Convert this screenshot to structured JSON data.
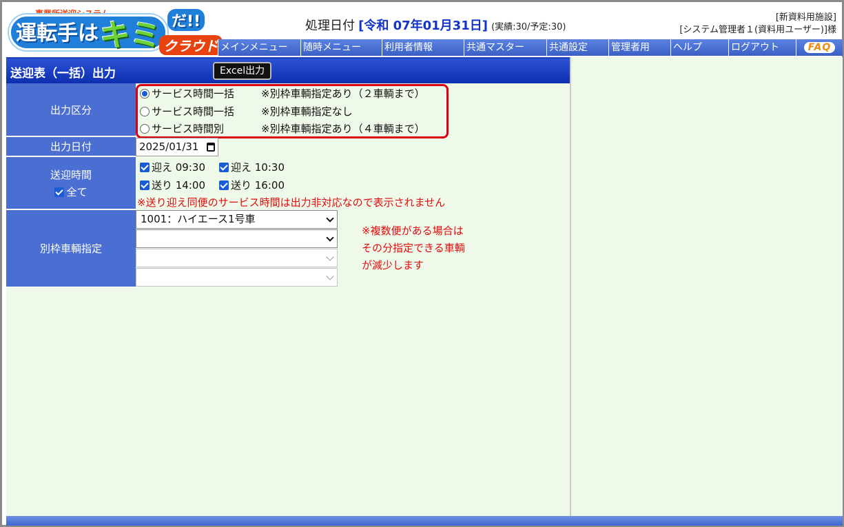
{
  "header": {
    "logo_sub": "事業所送迎システム",
    "logo_main": "運転手は",
    "logo_kimi": "キミ",
    "logo_da": "だ!!",
    "logo_cloud": "クラウド",
    "processing_label": "処理日付",
    "processing_date": "[令和 07年01月31日]",
    "status": "(実績:30/予定:30)",
    "facility": "[新資料用施設]",
    "user": "[システム管理者１(資料用ユーザー)]様"
  },
  "menu": [
    {
      "label": "メインメニュー"
    },
    {
      "label": "随時メニュー"
    },
    {
      "label": "利用者情報"
    },
    {
      "label": "共通マスター"
    },
    {
      "label": "共通設定"
    },
    {
      "label": "管理者用"
    },
    {
      "label": "ヘルプ"
    },
    {
      "label": "ログアウト"
    }
  ],
  "faq_label": "FAQ",
  "page": {
    "title": "送迎表（一括）出力",
    "excel_button": "Excel出力"
  },
  "output_type": {
    "label": "出力区分",
    "options": [
      {
        "label": "サービス時間一括",
        "note": "※別枠車輌指定あり（２車輌まで）",
        "selected": true
      },
      {
        "label": "サービス時間一括",
        "note": "※別枠車輌指定なし",
        "selected": false
      },
      {
        "label": "サービス時間別",
        "note": "※別枠車輌指定あり（４車輌まで）",
        "selected": false
      }
    ]
  },
  "output_date": {
    "label": "出力日付",
    "value": "2025/01/31"
  },
  "pickup_time": {
    "label": "送迎時間",
    "all_label": "全て",
    "items": [
      {
        "label": "迎え 09:30",
        "checked": true
      },
      {
        "label": "迎え 10:30",
        "checked": true
      },
      {
        "label": "送り 14:00",
        "checked": true
      },
      {
        "label": "送り 16:00",
        "checked": true
      }
    ],
    "warning": "※送り迎え同便のサービス時間は出力非対応なので表示されません"
  },
  "extra_vehicle": {
    "label": "別枠車輌指定",
    "selects": [
      {
        "value": "1001：ハイエース1号車",
        "enabled": true
      },
      {
        "value": "",
        "enabled": true
      },
      {
        "value": "",
        "enabled": false
      },
      {
        "value": "",
        "enabled": false
      }
    ],
    "note_lines": [
      "※複数便がある場合は",
      "その分指定できる車輌",
      "が減少します"
    ]
  }
}
